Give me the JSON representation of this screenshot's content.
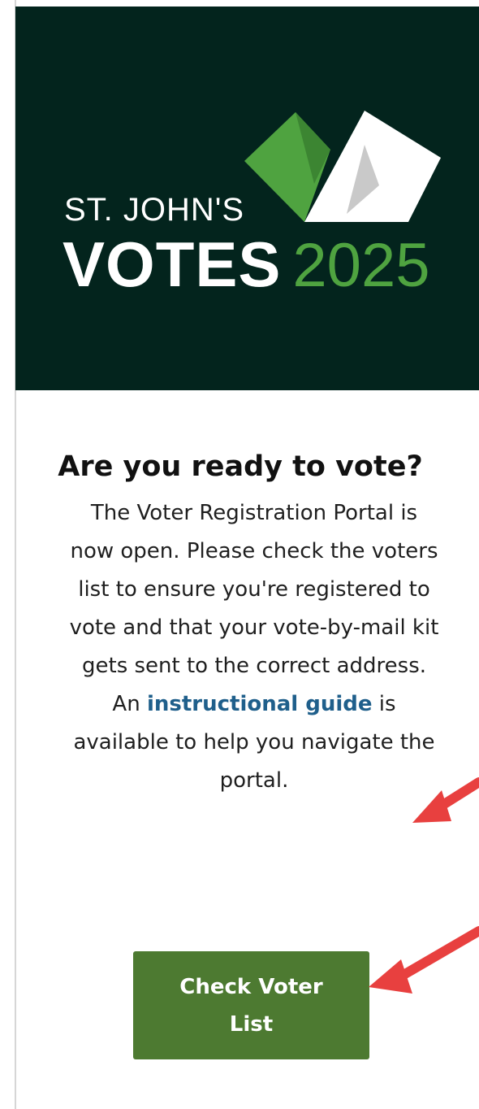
{
  "logo": {
    "top_text": "ST. JOHN'S",
    "main_text": "VOTES",
    "year": "2025"
  },
  "content": {
    "heading": "Are you ready to vote?",
    "body_before_link": "The Voter Registration Portal is now open. Please check the voters list to ensure you're registered to vote and that your vote-by-mail kit gets sent to the correct address. An ",
    "link_text": "instructional guide",
    "body_after_link": " is available to help you navigate the portal."
  },
  "cta": {
    "label": "Check Voter List"
  },
  "colors": {
    "hero_bg": "#03241d",
    "brand_green": "#4fa340",
    "button_green": "#4d7a31",
    "link_blue": "#1f5f8b",
    "annotation_arrow": "#e8403f"
  }
}
